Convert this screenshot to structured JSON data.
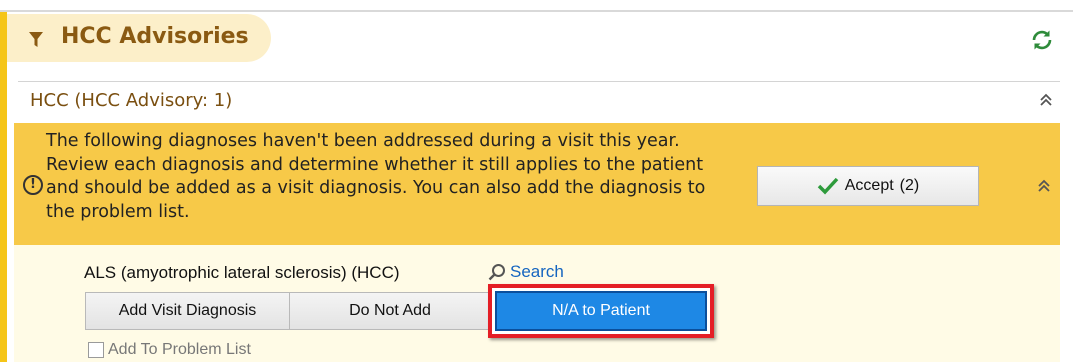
{
  "section": {
    "title": "HCC Advisories",
    "refresh_icon": "refresh-icon",
    "filter_icon": "filter-icon"
  },
  "advisory_group": {
    "title": "HCC (HCC Advisory: 1)"
  },
  "alert": {
    "icon": "info-icon",
    "icon_glyph": "!",
    "message": "The following diagnoses haven't been addressed during a visit this year. Review each diagnosis and determine whether it still applies to the patient and should be added as a visit diagnosis. You can also add the diagnosis to the problem list.",
    "accept_label": "Accept",
    "accept_count": "(2)"
  },
  "diagnosis": {
    "name": "ALS (amyotrophic lateral sclerosis) (HCC)",
    "search_label": "Search",
    "options": {
      "add": "Add Visit Diagnosis",
      "do_not_add": "Do Not Add",
      "na": "N/A to Patient"
    },
    "problem_list_label": "Add To Problem List"
  },
  "colors": {
    "accent": "#f5c518",
    "alert_bg": "#f7c948",
    "detail_bg": "#fffbe6",
    "title_brown": "#8a5a12",
    "selected_blue": "#1e88e5",
    "highlight_red": "#e41e26"
  }
}
